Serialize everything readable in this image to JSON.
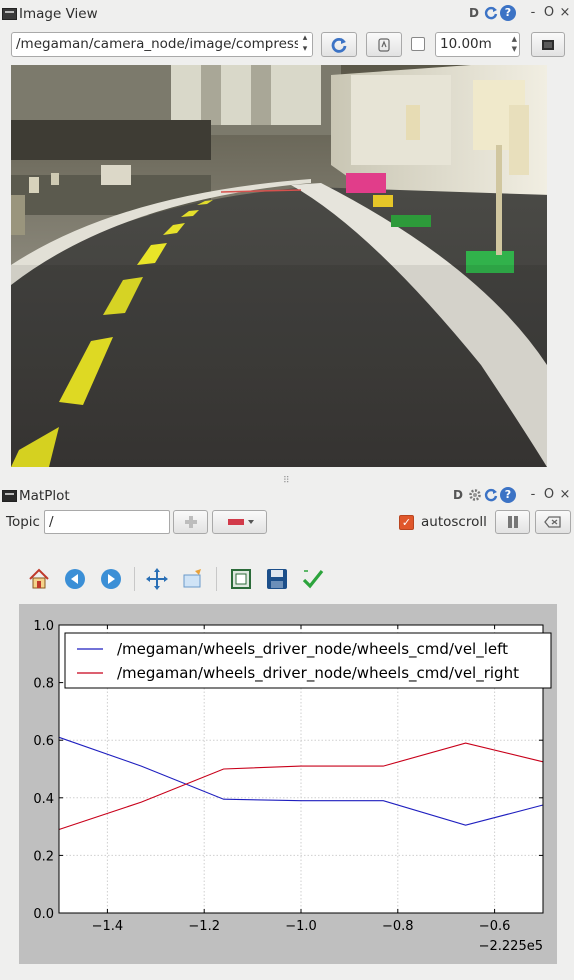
{
  "image_view": {
    "title": "Image View",
    "topic_value": "/megaman/camera_node/image/compress",
    "zoom_value": "10.00m",
    "smooth_checked": false,
    "camera_image_description": "camera image of a track"
  },
  "matplot": {
    "title": "MatPlot",
    "topic_label": "Topic",
    "topic_value": "/",
    "autoscroll_label": "autoscroll",
    "autoscroll_checked": true
  },
  "dock_controls": {
    "dc_label": "D",
    "help_label": "?",
    "minimize_label": "-",
    "float_label": "O",
    "close_label": "×"
  },
  "toolbar_icons": [
    "home-icon",
    "back-icon",
    "forward-icon",
    "pan-icon",
    "zoom-icon",
    "subplots-icon",
    "save-icon",
    "edit-curves-icon"
  ],
  "colors": {
    "accent": "#e0572b",
    "series_left": "#1f1fbf",
    "series_right": "#c8001a",
    "plot_bg": "#bfbfbf"
  },
  "chart_data": {
    "type": "line",
    "x_offset_label": "−2.225e5",
    "xlim": [
      -1.5,
      -0.5
    ],
    "ylim": [
      0.0,
      1.0
    ],
    "x_ticks": [
      -1.4,
      -1.2,
      -1.0,
      -0.8,
      -0.6
    ],
    "x_tick_labels": [
      "−1.4",
      "−1.2",
      "−1.0",
      "−0.8",
      "−0.6"
    ],
    "y_ticks": [
      0.0,
      0.2,
      0.4,
      0.6,
      0.8,
      1.0
    ],
    "y_tick_labels": [
      "0.0",
      "0.2",
      "0.4",
      "0.6",
      "0.8",
      "1.0"
    ],
    "grid": true,
    "legend_position": "top",
    "series": [
      {
        "name": "/megaman/wheels_driver_node/wheels_cmd/vel_left",
        "color": "#1f1fbf",
        "x": [
          -1.5,
          -1.33,
          -1.16,
          -1.0,
          -0.83,
          -0.66,
          -0.5
        ],
        "y": [
          0.61,
          0.51,
          0.395,
          0.39,
          0.39,
          0.305,
          0.375
        ]
      },
      {
        "name": "/megaman/wheels_driver_node/wheels_cmd/vel_right",
        "color": "#c8001a",
        "x": [
          -1.5,
          -1.33,
          -1.16,
          -1.0,
          -0.83,
          -0.66,
          -0.5
        ],
        "y": [
          0.29,
          0.385,
          0.5,
          0.51,
          0.51,
          0.59,
          0.525
        ]
      }
    ]
  }
}
